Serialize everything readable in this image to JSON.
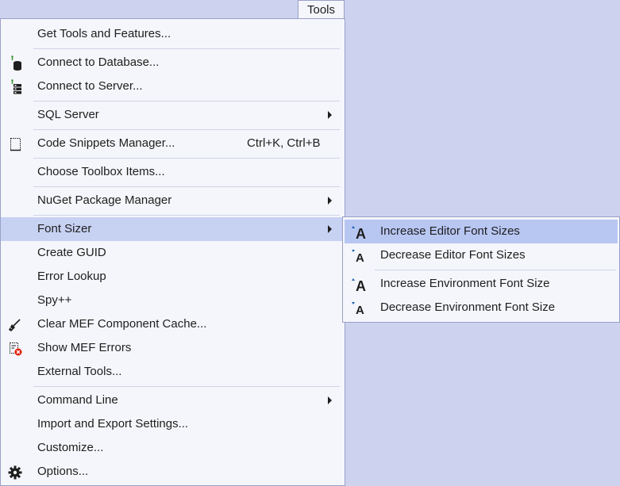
{
  "menubar": {
    "tools_label": "Tools"
  },
  "tools_menu": {
    "get_tools": "Get Tools and Features...",
    "connect_database": "Connect to Database...",
    "connect_server": "Connect to Server...",
    "sql_server": "SQL Server",
    "code_snippets": "Code Snippets Manager...",
    "code_snippets_shortcut": "Ctrl+K, Ctrl+B",
    "choose_toolbox": "Choose Toolbox Items...",
    "nuget": "NuGet Package Manager",
    "font_sizer": "Font Sizer",
    "create_guid": "Create GUID",
    "error_lookup": "Error Lookup",
    "spy": "Spy++",
    "clear_mef": "Clear MEF Component Cache...",
    "show_mef_errors": "Show MEF Errors",
    "external_tools": "External Tools...",
    "command_line": "Command Line",
    "import_export": "Import and Export Settings...",
    "customize": "Customize...",
    "options": "Options..."
  },
  "font_sizer_submenu": {
    "increase_editor": "Increase Editor Font Sizes",
    "decrease_editor": "Decrease Editor Font Sizes",
    "increase_env": "Increase Environment Font Size",
    "decrease_env": "Decrease Environment Font Size"
  },
  "colors": {
    "background": "#cdd2ee",
    "menu_bg": "#f5f6fb",
    "highlight": "#c7d1f2",
    "border": "#9aa0c8"
  },
  "icons": [
    "database-icon",
    "server-icon",
    "snippet-icon",
    "clear-cache-icon",
    "mef-errors-icon",
    "options-gear-icon",
    "increase-font-icon",
    "decrease-font-icon"
  ]
}
